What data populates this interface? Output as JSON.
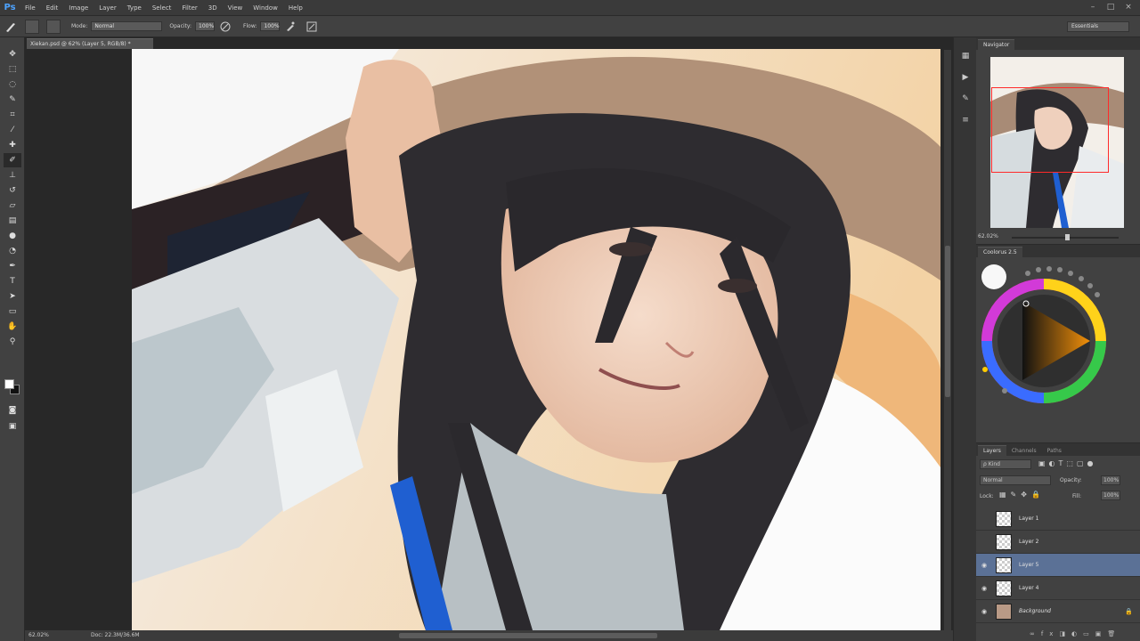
{
  "app": {
    "logo": "Ps"
  },
  "menu": [
    "File",
    "Edit",
    "Image",
    "Layer",
    "Type",
    "Select",
    "Filter",
    "3D",
    "View",
    "Window",
    "Help"
  ],
  "window_controls": [
    "–",
    "□",
    "×"
  ],
  "options": {
    "mode_label": "Mode:",
    "mode_value": "Normal",
    "opacity_label": "Opacity:",
    "opacity_value": "100%",
    "flow_label": "Flow:",
    "flow_value": "100%",
    "workspace": "Essentials"
  },
  "document": {
    "tab": "Xiekan.psd @ 62% (Layer 5, RGB/8) *",
    "zoom": "62.02%",
    "doc_size": "Doc: 22.3M/36.6M"
  },
  "panels": {
    "navigator_tab": "Navigator",
    "navigator_zoom": "62.02%",
    "coolorus_tab": "Coolorus 2.5",
    "layers_tabs": [
      "Layers",
      "Channels",
      "Paths"
    ],
    "kind_label": "ρ Kind",
    "blend_mode": "Normal",
    "opacity_label": "Opacity:",
    "opacity_value": "100%",
    "lock_label": "Lock:",
    "fill_label": "Fill:",
    "fill_value": "100%"
  },
  "layers": [
    {
      "name": "Layer 1",
      "visible": false,
      "selected": false
    },
    {
      "name": "Layer 2",
      "visible": false,
      "selected": false
    },
    {
      "name": "Layer 5",
      "visible": true,
      "selected": true
    },
    {
      "name": "Layer 4",
      "visible": true,
      "selected": false
    },
    {
      "name": "Background",
      "visible": true,
      "selected": false,
      "locked": true
    }
  ],
  "colors": {
    "accent": "#5b7196",
    "foreground": "#ffffff",
    "background": "#111111"
  }
}
